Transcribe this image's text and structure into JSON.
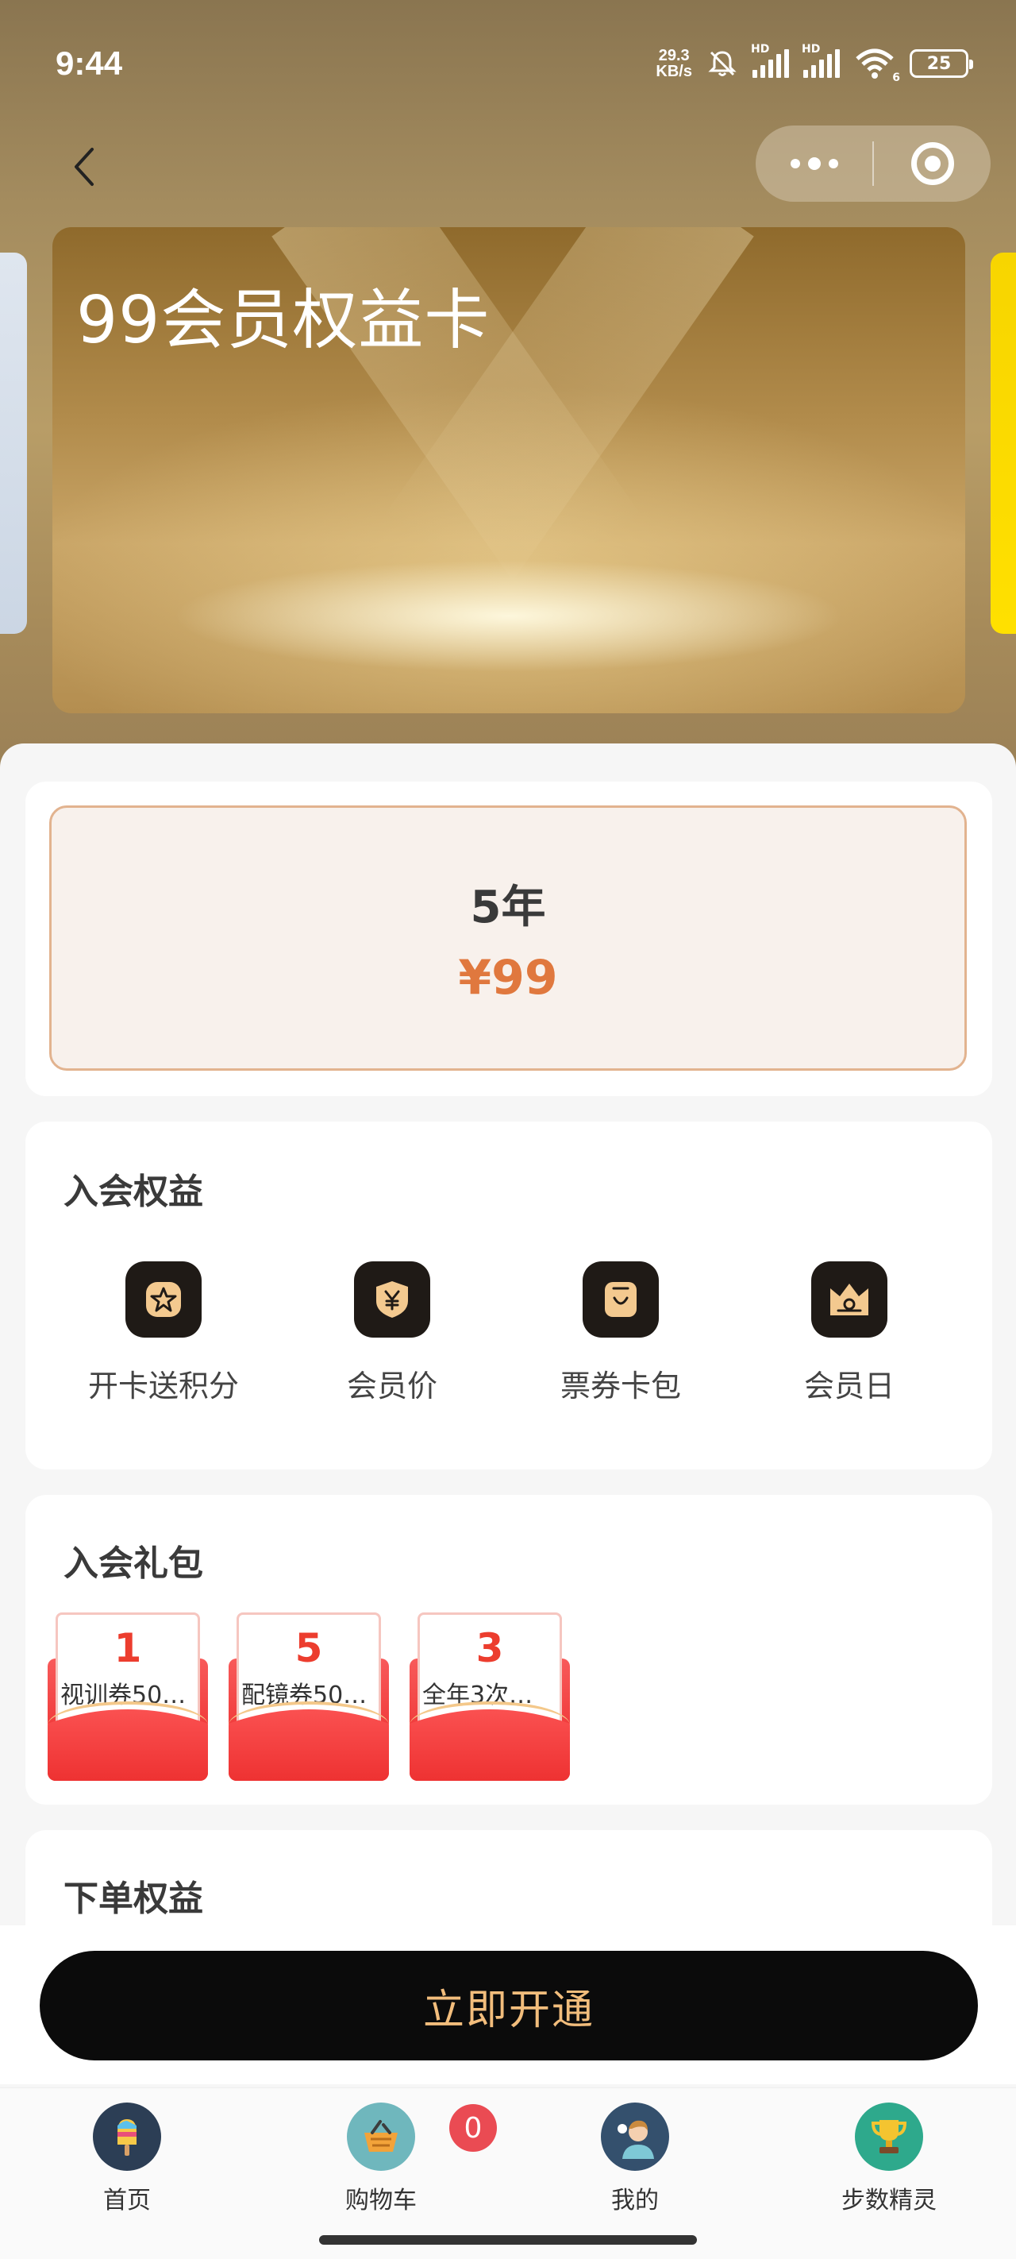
{
  "status_bar": {
    "time": "9:44",
    "net_speed_value": "29.3",
    "net_speed_unit": "KB/s",
    "hd_label": "HD",
    "wifi_sub": "6",
    "battery": "25"
  },
  "card": {
    "title": "99会员权益卡"
  },
  "plan": {
    "duration": "5年",
    "price": "¥99"
  },
  "benefits": {
    "title": "入会权益",
    "items": [
      {
        "label": "开卡送积分",
        "icon": "star-badge-icon"
      },
      {
        "label": "会员价",
        "icon": "yuan-shield-icon"
      },
      {
        "label": "票券卡包",
        "icon": "ticket-wallet-icon"
      },
      {
        "label": "会员日",
        "icon": "crown-icon"
      }
    ]
  },
  "gifts": {
    "title": "入会礼包",
    "items": [
      {
        "count": "1",
        "name": "视训券50…"
      },
      {
        "count": "5",
        "name": "配镜券50…"
      },
      {
        "count": "3",
        "name": "全年3次…"
      }
    ]
  },
  "order_benefits": {
    "title": "下单权益"
  },
  "cta": {
    "label": "立即开通"
  },
  "tabbar": {
    "items": [
      {
        "label": "首页",
        "icon": "popsicle-icon"
      },
      {
        "label": "购物车",
        "icon": "basket-icon"
      },
      {
        "label": "我的",
        "icon": "person-avatar-icon"
      },
      {
        "label": "步数精灵",
        "icon": "trophy-icon"
      }
    ],
    "cart_badge": "0"
  },
  "colors": {
    "accent_price": "#e0783e",
    "cta_bg": "#0b0b0b",
    "cta_text": "#f2bd7c",
    "gift_red": "#ec3d2e"
  }
}
